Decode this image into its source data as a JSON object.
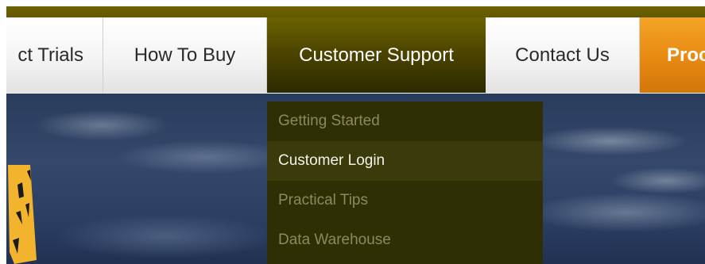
{
  "nav": {
    "tabs": [
      {
        "label": "ct Trials"
      },
      {
        "label": "How To Buy"
      },
      {
        "label": "Customer Support",
        "active": true
      },
      {
        "label": "Contact Us"
      },
      {
        "label": "Proc"
      }
    ]
  },
  "dropdown": {
    "items": [
      {
        "label": "Getting Started"
      },
      {
        "label": "Customer Login",
        "highlighted": true
      },
      {
        "label": "Practical Tips"
      },
      {
        "label": "Data Warehouse"
      }
    ]
  },
  "colors": {
    "olive_dark": "#2f2f05",
    "olive_accent": "#6f6400",
    "orange": "#e98c13",
    "sky": "#2a3c5c",
    "emblem": "#f2b42c"
  }
}
